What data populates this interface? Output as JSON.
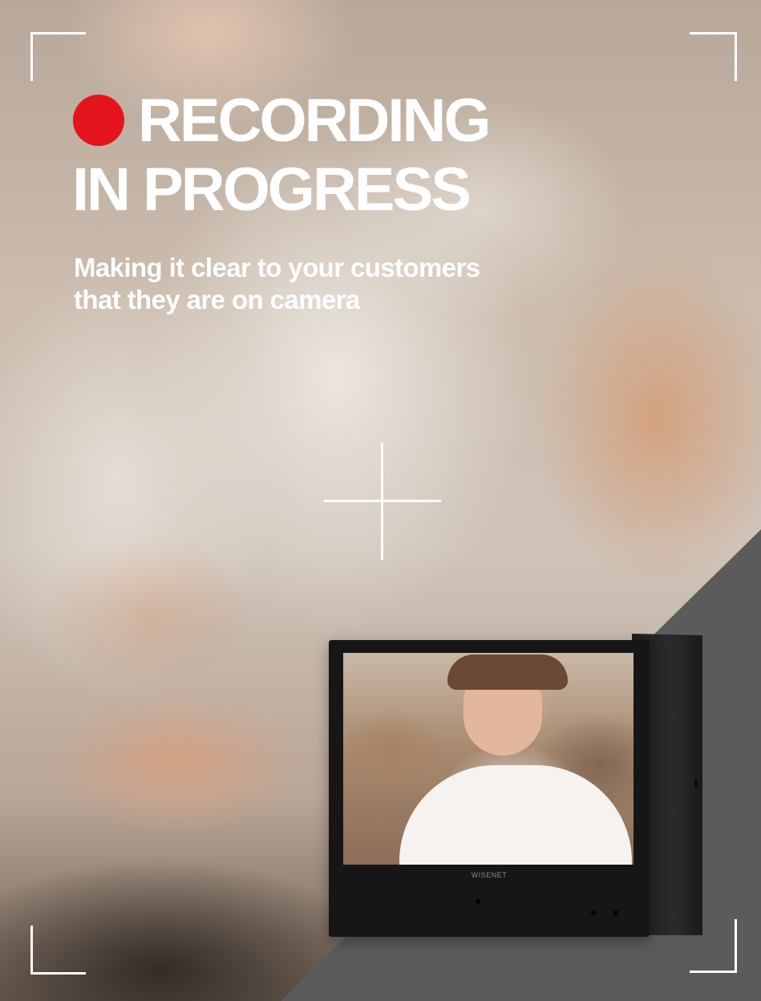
{
  "headline": {
    "line1": "RECORDING",
    "line2": "IN PROGRESS"
  },
  "subtitle": {
    "line1": "Making it clear to your customers",
    "line2": "that they are on camera"
  },
  "monitor": {
    "brand_text": "WISENET"
  },
  "colors": {
    "record_dot": "#e3141b",
    "text": "#ffffff",
    "wedge": "#5b5b5b"
  },
  "icons": [
    "record-dot-icon",
    "crosshair-icon",
    "viewfinder-corner-icon"
  ]
}
